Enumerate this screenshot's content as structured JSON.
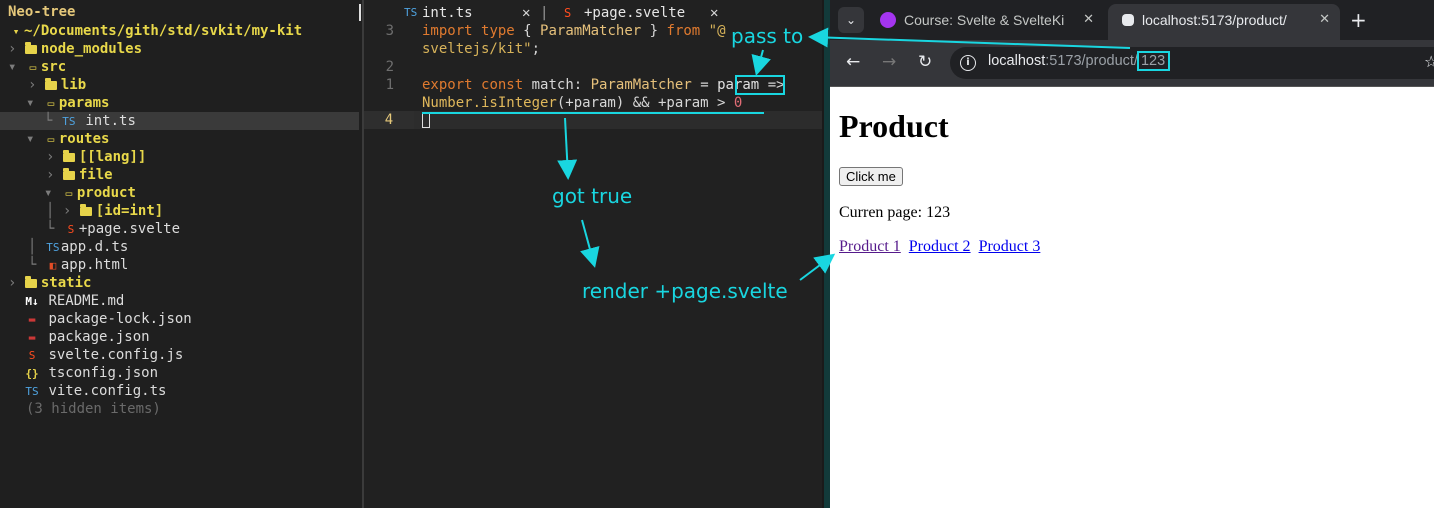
{
  "tree": {
    "title": "Neo-tree",
    "items": [
      {
        "name": "~/Documents/gith/std/svkit/my-kit",
        "icon": "folder-open-icon"
      },
      {
        "name": "node_modules",
        "icon": "folder-icon"
      },
      {
        "name": "src",
        "icon": "folder-open-icon"
      },
      {
        "name": "lib",
        "icon": "folder-icon"
      },
      {
        "name": "params",
        "icon": "folder-open-icon"
      },
      {
        "name": "int.ts",
        "icon": "typescript-icon",
        "badge": "TS"
      },
      {
        "name": "routes",
        "icon": "folder-open-icon"
      },
      {
        "name": "[[lang]]",
        "icon": "folder-icon"
      },
      {
        "name": "file",
        "icon": "folder-icon"
      },
      {
        "name": "product",
        "icon": "folder-open-icon"
      },
      {
        "name": "[id=int]",
        "icon": "folder-icon"
      },
      {
        "name": "+page.svelte",
        "icon": "svelte-icon"
      },
      {
        "name": "app.d.ts",
        "icon": "typescript-icon",
        "badge": "TS"
      },
      {
        "name": "app.html",
        "icon": "html-icon"
      },
      {
        "name": "static",
        "icon": "folder-icon"
      },
      {
        "name": "README.md",
        "icon": "markdown-icon",
        "badge": "M↓"
      },
      {
        "name": "package-lock.json",
        "icon": "npm-icon"
      },
      {
        "name": "package.json",
        "icon": "npm-icon"
      },
      {
        "name": "svelte.config.js",
        "icon": "svelte-icon"
      },
      {
        "name": "tsconfig.json",
        "icon": "json-icon",
        "badge": "{}"
      },
      {
        "name": "vite.config.ts",
        "icon": "typescript-icon",
        "badge": "TS"
      },
      {
        "name": "(3 hidden items)",
        "icon": ""
      }
    ]
  },
  "editor": {
    "tabs": [
      {
        "label": "int.ts",
        "badge": "TS"
      },
      {
        "label": "+page.svelte"
      }
    ],
    "line_numbers": [
      "3",
      "2",
      "1",
      "4"
    ],
    "code": {
      "l3a_kw1": "import",
      "l3a_kw2": "type",
      "l3a_p1": "{",
      "l3a_type": "ParamMatcher",
      "l3a_p2": "}",
      "l3a_kw3": "from",
      "l3a_str": "\"@",
      "l3b_str": "sveltejs/kit\"",
      "l3b_semi": ";",
      "l1a_kw1": "export",
      "l1a_kw2": "const",
      "l1a_name": "match:",
      "l1a_type": "ParamMatcher",
      "l1a_eq": "=",
      "l1a_param": "param",
      "l1a_arrow": "=>",
      "l1b_fn": "Number.isInteger",
      "l1b_mid": "(+param) && +param >",
      "l1b_num": "0"
    }
  },
  "annotations": {
    "pass_to": "pass to",
    "got_true": "got true",
    "render": "render +page.svelte",
    "color": "#19d6e0"
  },
  "browser": {
    "tabs": [
      {
        "title": "Course: Svelte & SvelteKi",
        "favicon": "udemy-icon"
      },
      {
        "title": "localhost:5173/product/",
        "favicon": "svelte-icon"
      }
    ],
    "url_host": "localhost",
    "url_path": ":5173/product/",
    "url_param": "123",
    "page": {
      "heading": "Product",
      "button": "Click me",
      "current": "Curren page: 123",
      "links": [
        "Product 1",
        "Product 2",
        "Product 3"
      ]
    }
  }
}
